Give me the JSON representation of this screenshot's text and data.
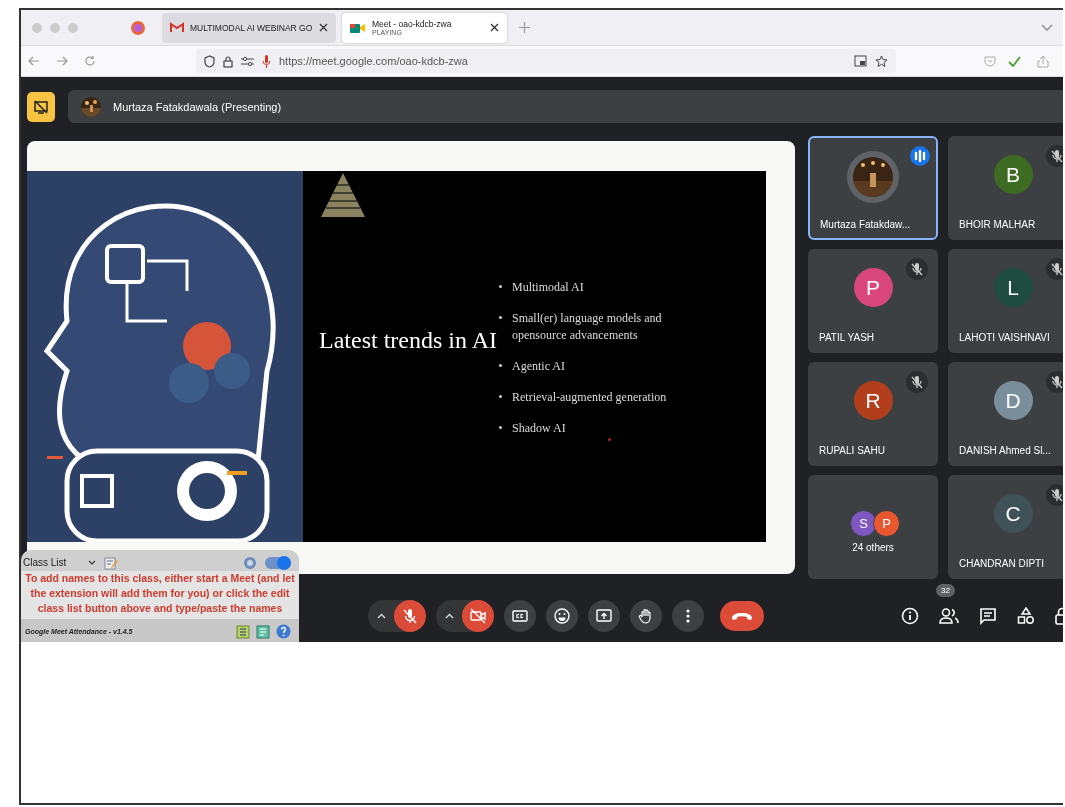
{
  "browser": {
    "tabs": [
      {
        "title": "MULTIMODAL AI WEBINAR GO",
        "kind": "mail",
        "selected": false
      },
      {
        "title": "Meet - oao-kdcb-zwa",
        "subtitle": "PLAYING",
        "kind": "meet",
        "selected": true
      }
    ],
    "url": "https://meet.google.com/oao-kdcb-zwa"
  },
  "meet": {
    "presenter": "Murtaza Fatakdawala (Presenting)",
    "slide": {
      "title": "Latest trends in AI",
      "bullets": [
        "Multimodal AI",
        "Small(er) language models and opensource advancements",
        "Agentic AI",
        "Retrieval-augmented generation",
        "Shadow AI"
      ]
    },
    "tiles": [
      {
        "name": "Murtaza Fatakdaw...",
        "speaking": true,
        "muted": false
      },
      {
        "kind": "avatar",
        "name": "BHOIR MALHAR",
        "initial": "B",
        "color": "#3d6b22",
        "speaking": false,
        "muted": true
      },
      {
        "kind": "avatar",
        "name": "PATIL YASH",
        "initial": "P",
        "color": "#d9467a",
        "speaking": false,
        "muted": true
      },
      {
        "kind": "avatar",
        "name": "LAHOTI VAISHNAVI",
        "initial": "L",
        "color": "#1e4d3f",
        "speaking": false,
        "muted": true
      },
      {
        "kind": "avatar",
        "name": "RUPALI SAHU",
        "initial": "R",
        "color": "#b23e1c",
        "speaking": false,
        "muted": true
      },
      {
        "kind": "avatar",
        "name": "DANISH Ahmed Sl...",
        "initial": "D",
        "color": "#7a8e9c",
        "speaking": false,
        "muted": true
      },
      {
        "kind": "others",
        "name": "24 others",
        "avatars": [
          {
            "initial": "S",
            "color": "#7e57c2"
          },
          {
            "initial": "P",
            "color": "#e8572f"
          }
        ],
        "speaking": false,
        "muted": false
      },
      {
        "kind": "avatar",
        "name": "CHANDRAN DIPTI",
        "initial": "C",
        "color": "#3f5258",
        "speaking": false,
        "muted": true
      }
    ],
    "controls": {
      "mic_on": false,
      "camera_on": false,
      "people_count": "32"
    },
    "attendance": {
      "title": "Class List",
      "enabled": true,
      "message": "To add names to this class, either start a Meet (and let the extension will add them for you) or click the edit class list button above and type/paste the names",
      "footer": "Google Meet Attendance - v1.4.5"
    }
  }
}
